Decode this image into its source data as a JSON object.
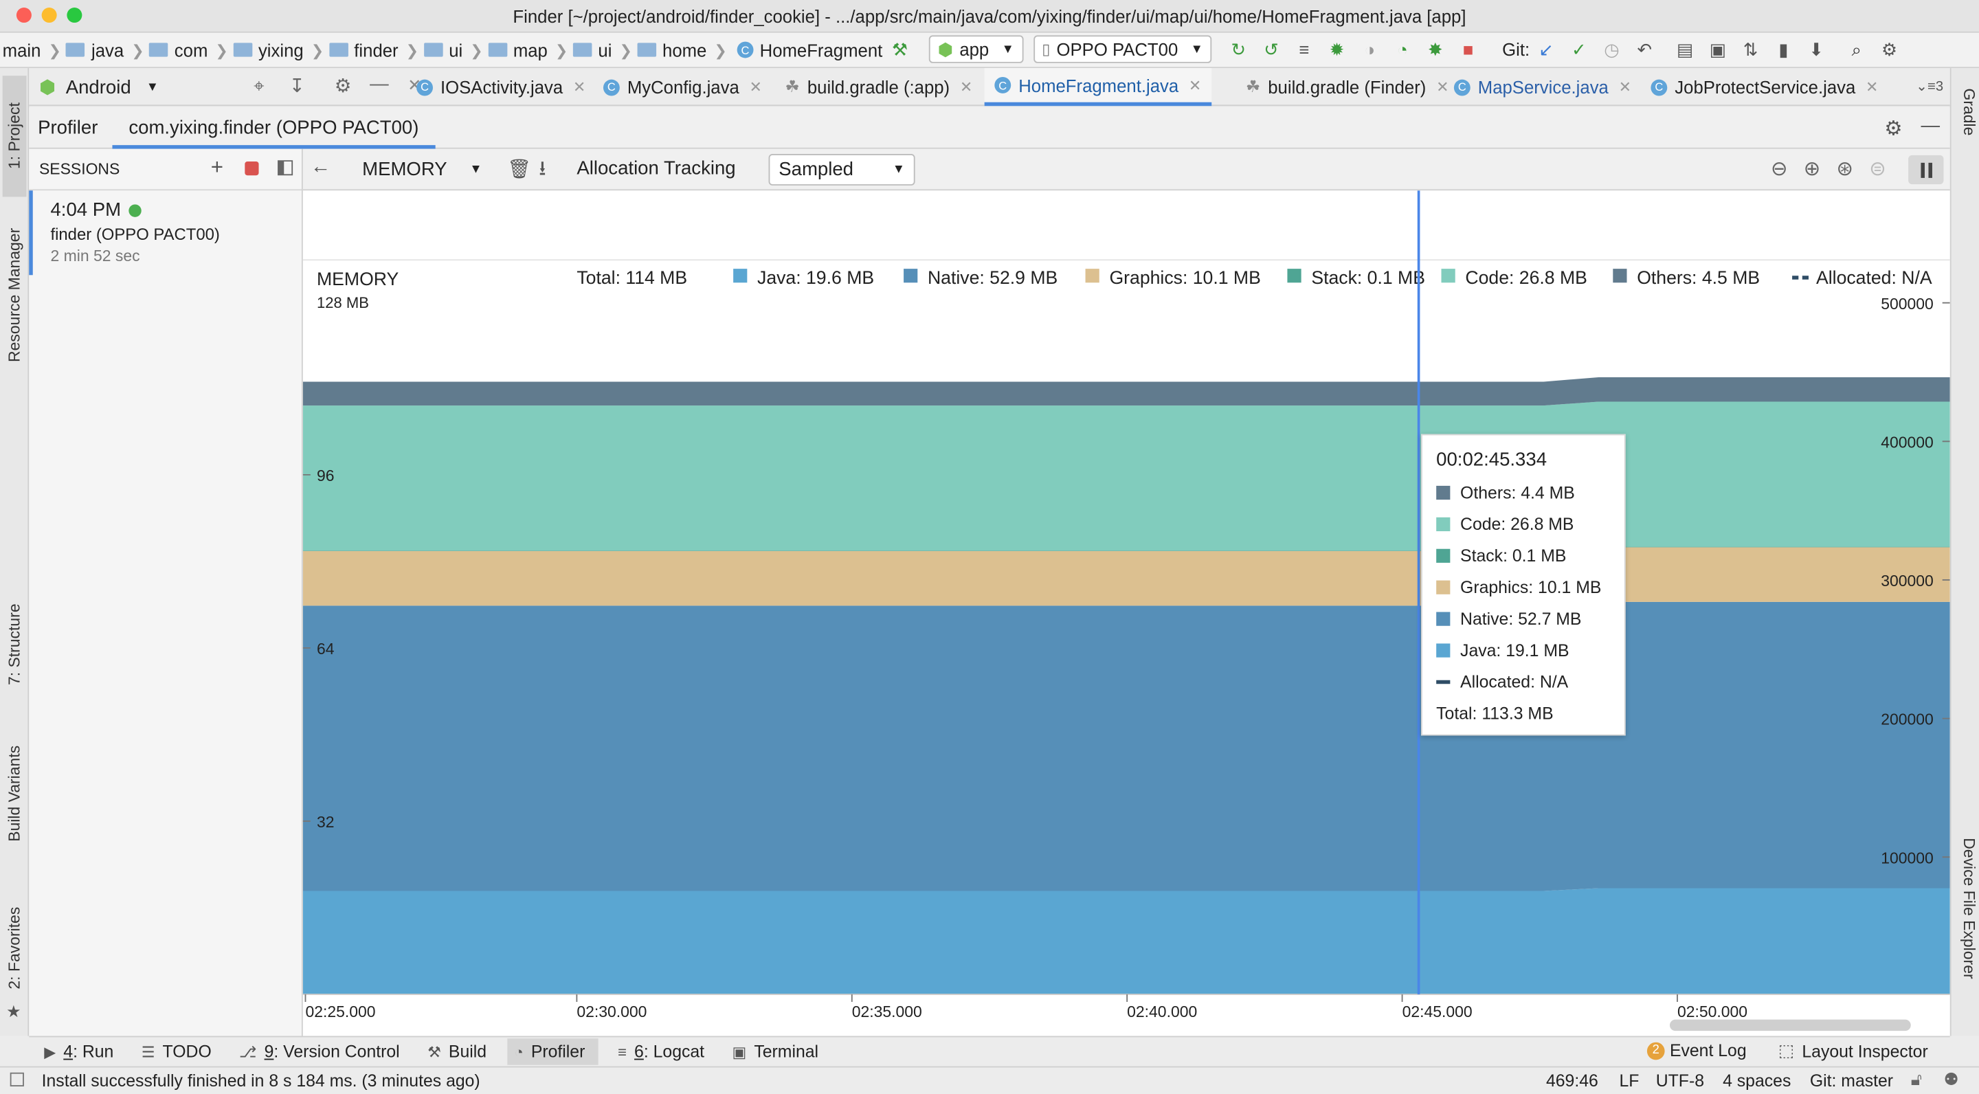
{
  "window": {
    "title": "Finder [~/project/android/finder_cookie] - .../app/src/main/java/com/yixing/finder/ui/map/ui/home/HomeFragment.java [app]"
  },
  "breadcrumbs": [
    "main",
    "java",
    "com",
    "yixing",
    "finder",
    "ui",
    "map",
    "ui",
    "home",
    "HomeFragment"
  ],
  "toolbar": {
    "run_config": "app",
    "device": "OPPO PACT00",
    "git_label": "Git:"
  },
  "project_view": {
    "label": "Android"
  },
  "left_strip": {
    "project": "1: Project",
    "resource_manager": "Resource Manager",
    "structure": "7: Structure",
    "build_variants": "Build Variants",
    "favorites": "2: Favorites"
  },
  "right_strip": {
    "gradle": "Gradle",
    "device_file_explorer": "Device File Explorer"
  },
  "editor_tabs": [
    {
      "label": "IOSActivity.java",
      "icon": "class-icon"
    },
    {
      "label": "MyConfig.java",
      "icon": "class-icon"
    },
    {
      "label": "build.gradle (:app)",
      "icon": "gradle-icon"
    },
    {
      "label": "HomeFragment.java",
      "icon": "class-icon",
      "active": true
    },
    {
      "label": "build.gradle (Finder)",
      "icon": "gradle-icon"
    },
    {
      "label": "MapService.java",
      "icon": "class-icon"
    },
    {
      "label": "JobProtectService.java",
      "icon": "class-icon"
    }
  ],
  "tabs_overflow": "3",
  "profiler": {
    "tab_label": "Profiler",
    "process_label": "com.yixing.finder (OPPO PACT00)"
  },
  "sessions": {
    "header": "SESSIONS",
    "items": [
      {
        "time": "4:04 PM",
        "name": "finder (OPPO PACT00)",
        "duration": "2 min 52 sec"
      }
    ]
  },
  "memory_toolbar": {
    "profiler_select": "MEMORY",
    "allocation_label": "Allocation Tracking",
    "allocation_select": "Sampled"
  },
  "chart_data": {
    "type": "area",
    "title": "MEMORY",
    "total_label": "Total: 114 MB",
    "legend": [
      {
        "name": "Java",
        "label": "Java: 19.6 MB",
        "color": "#5aa6d2"
      },
      {
        "name": "Native",
        "label": "Native: 52.9 MB",
        "color": "#568fb8"
      },
      {
        "name": "Graphics",
        "label": "Graphics: 10.1 MB",
        "color": "#dcc090"
      },
      {
        "name": "Stack",
        "label": "Stack: 0.1 MB",
        "color": "#4fa594"
      },
      {
        "name": "Code",
        "label": "Code: 26.8 MB",
        "color": "#81ccbd"
      },
      {
        "name": "Others",
        "label": "Others: 4.5 MB",
        "color": "#617b8e"
      },
      {
        "name": "Allocated",
        "label": "Allocated: N/A",
        "color": "#2f4d66",
        "dashed": true
      }
    ],
    "y_left": {
      "unit_label": "128 MB",
      "max": 128,
      "ticks": [
        {
          "v": 96,
          "label": "96"
        },
        {
          "v": 64,
          "label": "64"
        },
        {
          "v": 32,
          "label": "32"
        }
      ]
    },
    "y_right": {
      "max": 500000,
      "ticks": [
        {
          "v": 500000,
          "label": "500000"
        },
        {
          "v": 400000,
          "label": "400000"
        },
        {
          "v": 300000,
          "label": "300000"
        },
        {
          "v": 200000,
          "label": "200000"
        },
        {
          "v": 100000,
          "label": "100000"
        }
      ]
    },
    "x_ticks": [
      "02:25.000",
      "02:30.000",
      "02:35.000",
      "02:40.000",
      "02:45.000",
      "02:50.000"
    ],
    "x": [
      "02:25.0",
      "02:30.0",
      "02:35.0",
      "02:40.0",
      "02:45.0",
      "02:47.5",
      "02:48.5",
      "02:50.0",
      "02:53.0"
    ],
    "series": [
      {
        "name": "Java",
        "values": [
          19.1,
          19.1,
          19.1,
          19.1,
          19.1,
          19.1,
          19.6,
          19.6,
          19.6
        ],
        "color": "#5aa6d2"
      },
      {
        "name": "Native",
        "values": [
          52.7,
          52.7,
          52.7,
          52.7,
          52.7,
          52.7,
          52.9,
          52.9,
          52.9
        ],
        "color": "#568fb8"
      },
      {
        "name": "Graphics",
        "values": [
          10.1,
          10.1,
          10.1,
          10.1,
          10.1,
          10.1,
          10.1,
          10.1,
          10.1
        ],
        "color": "#dcc090"
      },
      {
        "name": "Stack",
        "values": [
          0.1,
          0.1,
          0.1,
          0.1,
          0.1,
          0.1,
          0.1,
          0.1,
          0.1
        ],
        "color": "#4fa594"
      },
      {
        "name": "Code",
        "values": [
          26.8,
          26.8,
          26.8,
          26.8,
          26.8,
          26.8,
          26.8,
          26.8,
          26.8
        ],
        "color": "#81ccbd"
      },
      {
        "name": "Others",
        "values": [
          4.4,
          4.4,
          4.4,
          4.4,
          4.4,
          4.4,
          4.5,
          4.5,
          4.5
        ],
        "color": "#617b8e"
      }
    ],
    "cursor_x": "02:45.3",
    "tooltip": {
      "time": "00:02:45.334",
      "rows": [
        {
          "label": "Others: 4.4 MB",
          "color": "#617b8e"
        },
        {
          "label": "Code: 26.8 MB",
          "color": "#81ccbd"
        },
        {
          "label": "Stack: 0.1 MB",
          "color": "#4fa594"
        },
        {
          "label": "Graphics: 10.1 MB",
          "color": "#dcc090"
        },
        {
          "label": "Native: 52.7 MB",
          "color": "#568fb8"
        },
        {
          "label": "Java: 19.1 MB",
          "color": "#5aa6d2"
        },
        {
          "label": "Allocated: N/A",
          "color": "#2f4d66",
          "dashed": true
        }
      ],
      "total": "Total: 113.3 MB"
    }
  },
  "bottom_tools": [
    {
      "key": "4",
      "label": ": Run",
      "icon": "run-icon"
    },
    {
      "key": "",
      "label": "TODO",
      "icon": "todo-icon"
    },
    {
      "key": "9",
      "label": ": Version Control",
      "icon": "vcs-icon"
    },
    {
      "key": "",
      "label": "Build",
      "icon": "build-icon"
    },
    {
      "key": "",
      "label": "Profiler",
      "icon": "profiler-icon",
      "active": true
    },
    {
      "key": "6",
      "label": ": Logcat",
      "icon": "logcat-icon"
    },
    {
      "key": "",
      "label": "Terminal",
      "icon": "terminal-icon"
    }
  ],
  "bottom_right": {
    "event_log_count": "2",
    "event_log": "Event Log",
    "layout_inspector": "Layout Inspector"
  },
  "status": {
    "message": "Install successfully finished in 8 s 184 ms. (3 minutes ago)",
    "position": "469:46",
    "line_sep": "LF",
    "encoding": "UTF-8",
    "indent": "4 spaces",
    "git": "Git: master"
  }
}
